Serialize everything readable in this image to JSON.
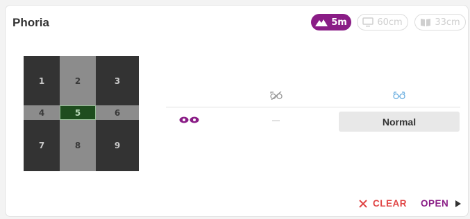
{
  "title": "Phoria",
  "distances": [
    {
      "label": "5m",
      "icon": "mountain-icon",
      "active": true
    },
    {
      "label": "60cm",
      "icon": "monitor-icon",
      "active": false
    },
    {
      "label": "33cm",
      "icon": "book-icon",
      "active": false
    }
  ],
  "grid": {
    "cells": [
      "1",
      "2",
      "3",
      "4",
      "5",
      "6",
      "7",
      "8",
      "9"
    ],
    "selected": "5"
  },
  "table": {
    "col1_icon": "glasses-off-icon",
    "col2_icon": "glasses-icon",
    "row_icon": "eyes-icon",
    "row_value_col1": "—",
    "row_value_col2": "Normal"
  },
  "actions": {
    "clear_label": "CLEAR",
    "open_label": "OPEN"
  },
  "colors": {
    "accent": "#8a1d86",
    "clear": "#e04444",
    "glasses_blue": "#6aaee0"
  }
}
